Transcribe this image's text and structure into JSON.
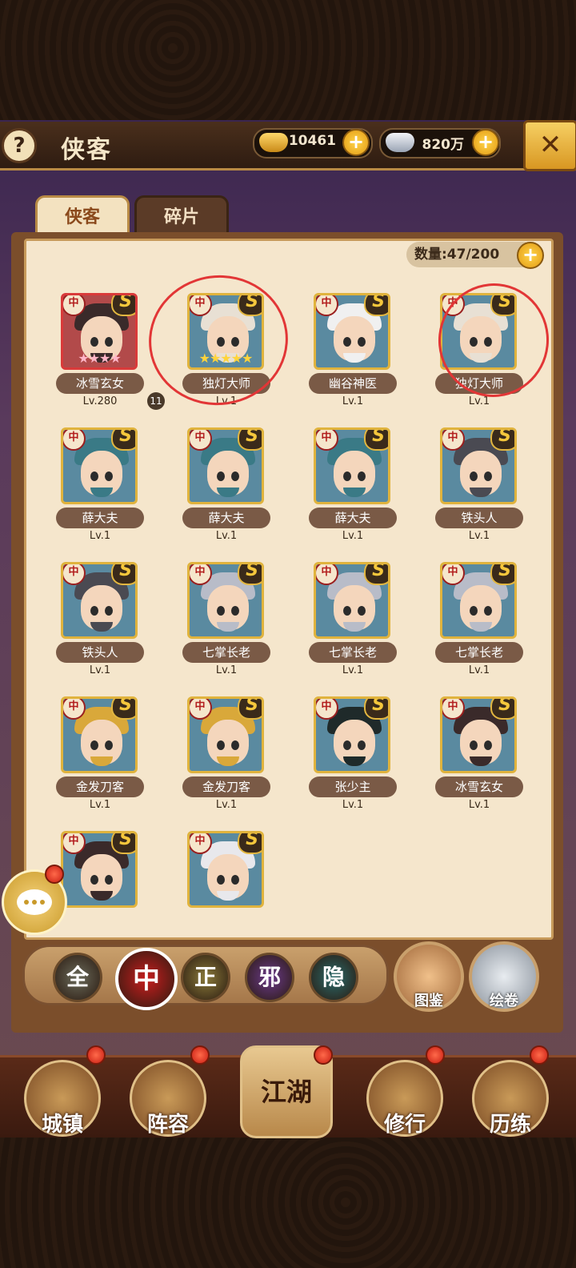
{
  "header": {
    "help_label": "?",
    "title": "侠客",
    "currency_gold": "10461",
    "currency_silver": "820万",
    "close_label": "✕"
  },
  "tabs": [
    {
      "label": "侠客"
    },
    {
      "label": "碎片"
    }
  ],
  "inventory": {
    "count_label": "数量:47/200"
  },
  "heroes": [
    {
      "name": "冰雪玄女",
      "level": "Lv.280",
      "grade": "中",
      "rank": "S",
      "stars": "★★★★",
      "badge": "11",
      "frame": "red",
      "hair": "#3a2a2a"
    },
    {
      "name": "独灯大师",
      "level": "Lv.1",
      "grade": "中",
      "rank": "S",
      "stars": "★★★★★",
      "frame": "gold",
      "hair": "#e8e0d4"
    },
    {
      "name": "幽谷神医",
      "level": "Lv.1",
      "grade": "中",
      "rank": "S",
      "frame": "gold",
      "hair": "#f0f0f0"
    },
    {
      "name": "独灯大师",
      "level": "Lv.1",
      "grade": "中",
      "rank": "S",
      "frame": "gold",
      "hair": "#e8e0d4"
    },
    {
      "name": "薛大夫",
      "level": "Lv.1",
      "grade": "中",
      "rank": "S",
      "frame": "gold",
      "hair": "#3a7a86"
    },
    {
      "name": "薛大夫",
      "level": "Lv.1",
      "grade": "中",
      "rank": "S",
      "frame": "gold",
      "hair": "#3a7a86"
    },
    {
      "name": "薛大夫",
      "level": "Lv.1",
      "grade": "中",
      "rank": "S",
      "frame": "gold",
      "hair": "#3a7a86"
    },
    {
      "name": "铁头人",
      "level": "Lv.1",
      "grade": "中",
      "rank": "S",
      "frame": "gold",
      "hair": "#4a4a52"
    },
    {
      "name": "铁头人",
      "level": "Lv.1",
      "grade": "中",
      "rank": "S",
      "frame": "gold",
      "hair": "#4a4a52"
    },
    {
      "name": "七掌长老",
      "level": "Lv.1",
      "grade": "中",
      "rank": "S",
      "frame": "gold",
      "hair": "#b8bcc8"
    },
    {
      "name": "七掌长老",
      "level": "Lv.1",
      "grade": "中",
      "rank": "S",
      "frame": "gold",
      "hair": "#b8bcc8"
    },
    {
      "name": "七掌长老",
      "level": "Lv.1",
      "grade": "中",
      "rank": "S",
      "frame": "gold",
      "hair": "#b8bcc8"
    },
    {
      "name": "金发刀客",
      "level": "Lv.1",
      "grade": "中",
      "rank": "S",
      "frame": "gold",
      "hair": "#d9a83a"
    },
    {
      "name": "金发刀客",
      "level": "Lv.1",
      "grade": "中",
      "rank": "S",
      "frame": "gold",
      "hair": "#d9a83a"
    },
    {
      "name": "张少主",
      "level": "Lv.1",
      "grade": "中",
      "rank": "S",
      "frame": "gold",
      "hair": "#1f2a2a"
    },
    {
      "name": "冰雪玄女",
      "level": "Lv.1",
      "grade": "中",
      "rank": "S",
      "frame": "gold",
      "hair": "#3a2a2a"
    },
    {
      "name": "",
      "level": "",
      "grade": "中",
      "rank": "S",
      "frame": "gold",
      "hair": "#3a2a2a"
    },
    {
      "name": "",
      "level": "",
      "grade": "中",
      "rank": "S",
      "frame": "gold",
      "hair": "#e8e8ec"
    }
  ],
  "filters": [
    {
      "label": "全",
      "color": "#6a6a5a"
    },
    {
      "label": "中",
      "color": "#c81e1e",
      "active": true
    },
    {
      "label": "正",
      "color": "#8a7a3a"
    },
    {
      "label": "邪",
      "color": "#6a3a8a"
    },
    {
      "label": "隐",
      "color": "#2a6a6a"
    }
  ],
  "round_buttons": [
    {
      "label": "图鉴"
    },
    {
      "label": "绘卷"
    }
  ],
  "nav": [
    {
      "label": "城镇"
    },
    {
      "label": "阵容"
    },
    {
      "label": "江湖"
    },
    {
      "label": "修行"
    },
    {
      "label": "历练"
    }
  ],
  "colors": {
    "accent": "#e0b33d",
    "panel": "#f5e6cc",
    "annotation": "#e23636"
  }
}
